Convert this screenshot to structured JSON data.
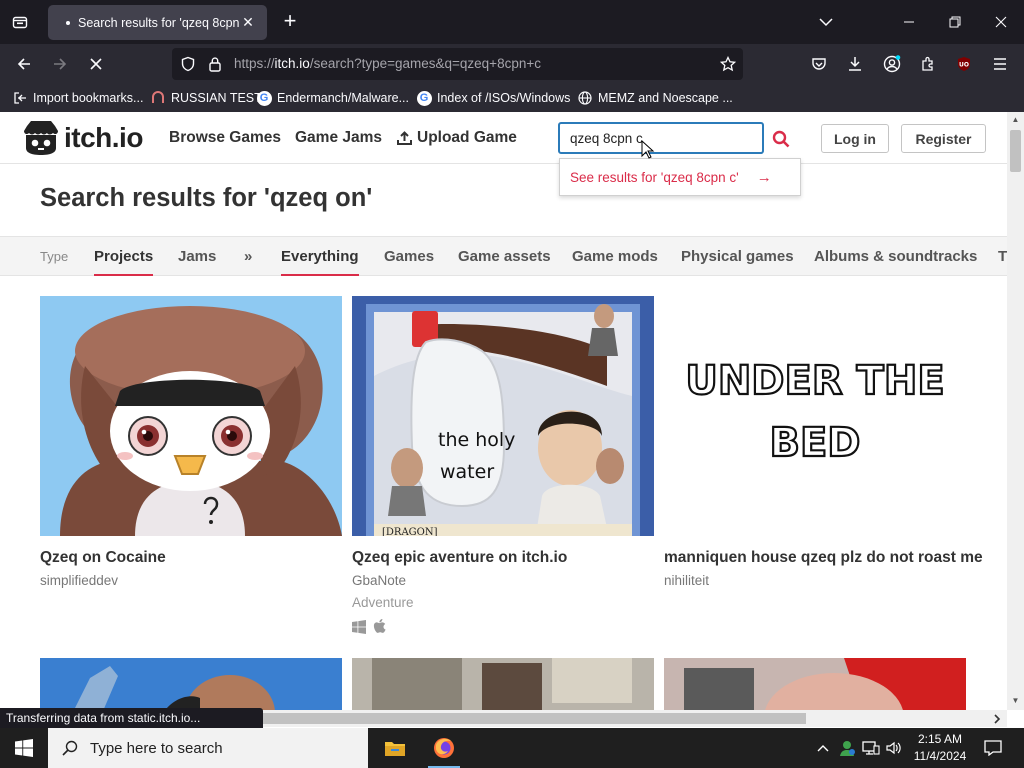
{
  "browser": {
    "tab_title": "Search results for 'qzeq 8cpn c'",
    "url_prefix": "https://",
    "url_host": "itch.io",
    "url_rest": "/search?type=games&q=qzeq+8cpn+c",
    "bookmarks": [
      {
        "label": "Import bookmarks...",
        "icon": "import-icon"
      },
      {
        "label": "RUSSIAN TEST",
        "icon": "site-favicon"
      },
      {
        "label": "Endermanch/Malware...",
        "icon": "google-icon"
      },
      {
        "label": "Index of /ISOs/Windows",
        "icon": "google-icon"
      },
      {
        "label": "MEMZ and Noescape ...",
        "icon": "globe-icon"
      }
    ],
    "status_text": "Transferring data from static.itch.io..."
  },
  "site": {
    "logo_text": "itch.io",
    "nav": {
      "browse": "Browse Games",
      "jams": "Game Jams",
      "upload": "Upload Game"
    },
    "search_value": "qzeq 8cpn c",
    "login": "Log in",
    "register": "Register",
    "suggestion": "See results for 'qzeq 8cpn c'",
    "suggestion_arrow": "→"
  },
  "search": {
    "title": "Search results for 'qzeq on'",
    "type_label": "Type",
    "tabs": [
      "Projects",
      "Jams"
    ],
    "more": "»",
    "categories": [
      "Everything",
      "Games",
      "Game assets",
      "Game mods",
      "Physical games",
      "Albums & soundtracks",
      "T"
    ]
  },
  "results": [
    {
      "title": "Qzeq on Cocaine",
      "author": "simplifieddev",
      "genre": "",
      "platforms": []
    },
    {
      "title": "Qzeq epic aventure on itch.io",
      "author": "GbaNote",
      "genre": "Adventure",
      "platforms": [
        "windows-icon",
        "apple-icon"
      ],
      "image_text": {
        "line1": "the holy",
        "line2": "water",
        "card_label": "[DRAGON]"
      }
    },
    {
      "title": "manniquen house qzeq plz do not roast me",
      "author": "nihiliteit",
      "genre": "",
      "platforms": [],
      "image_text": {
        "line1": "UNDER THE",
        "line2": "BED"
      }
    }
  ],
  "taskbar": {
    "search_placeholder": "Type here to search",
    "time": "2:15 AM",
    "date": "11/4/2024"
  },
  "colors": {
    "accent": "#da2c49",
    "focus": "#2b7bb9",
    "browser_dark": "#1c1b22",
    "browser_toolbar": "#2b2a33"
  }
}
